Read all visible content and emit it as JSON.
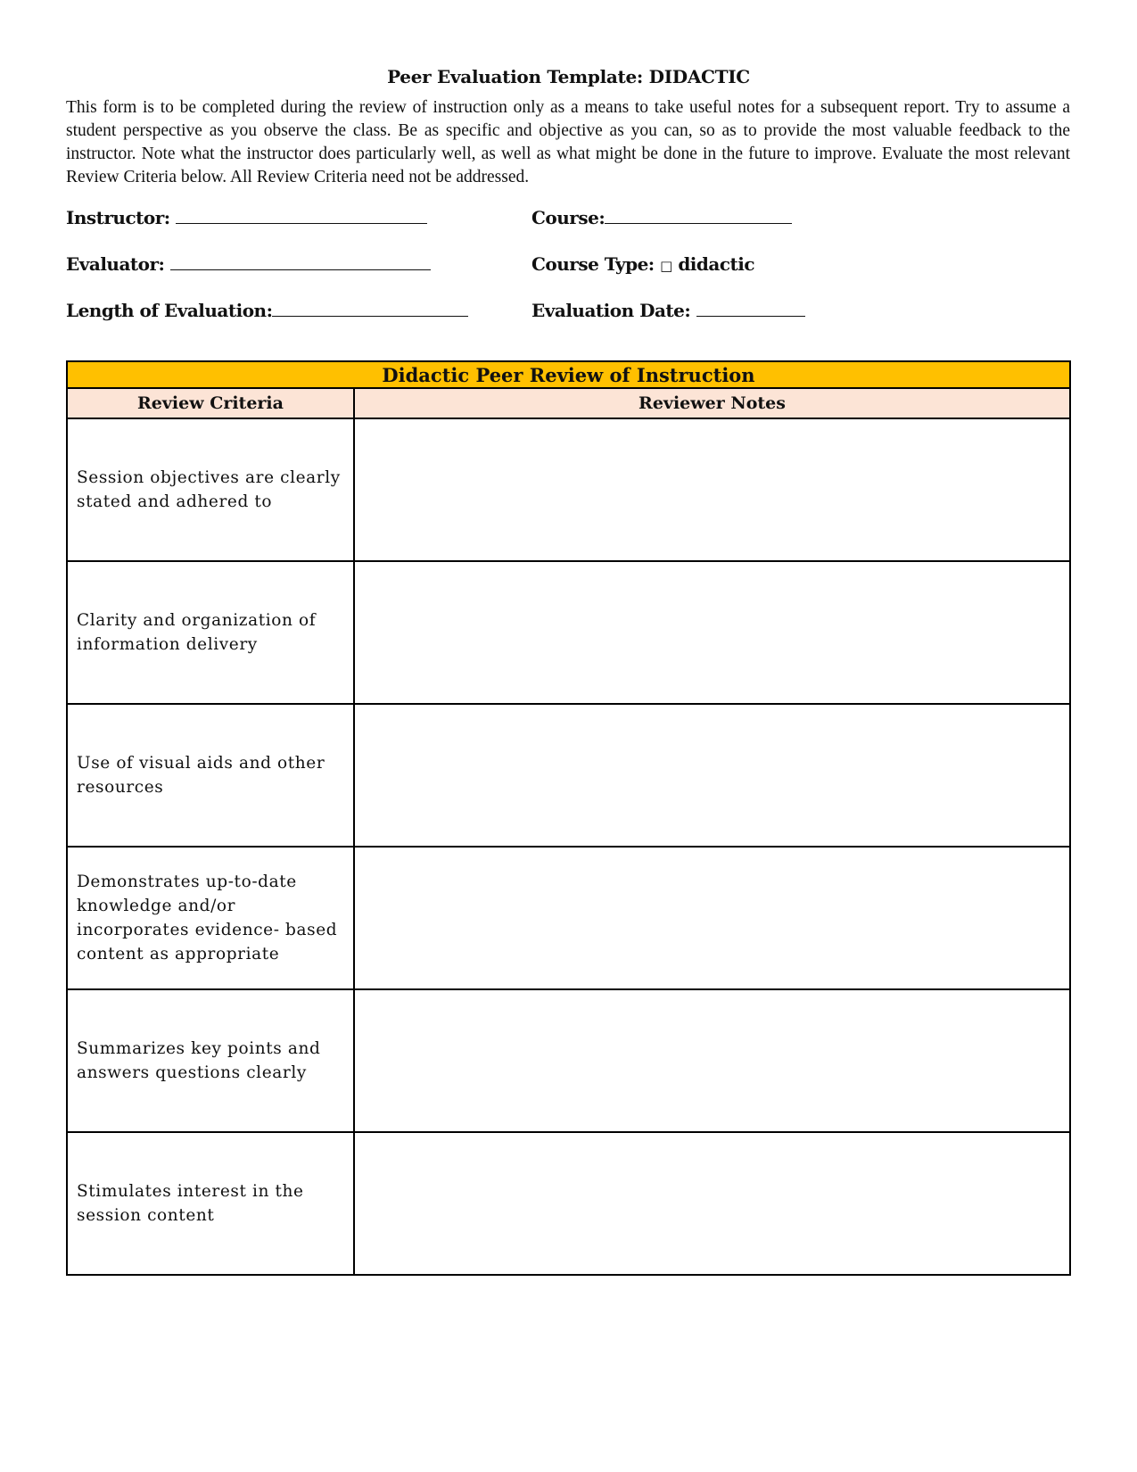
{
  "title": "Peer Evaluation Template: DIDACTIC",
  "intro": "This form is to be completed during the review of instruction only as a means to take useful notes for a subsequent report. Try to assume a student perspective as you observe the class. Be as specific and objective as you can, so as to provide the most valuable feedback to the instructor. Note what the instructor does particularly well, as well as what might be done in the future to improve. Evaluate the most relevant Review Criteria below. All Review Criteria need not be addressed.",
  "fields": {
    "instructor_label": "Instructor:",
    "course_label": "Course:",
    "evaluator_label": "Evaluator:",
    "course_type_label": "Course Type:",
    "course_type_option": "didactic",
    "checkbox_glyph": "□",
    "length_label": "Length of Evaluation:",
    "date_label": "Evaluation Date:"
  },
  "table": {
    "title": "Didactic Peer Review of Instruction",
    "col1": "Review Criteria",
    "col2": "Reviewer Notes",
    "rows": [
      "Session objectives are clearly stated and adhered to",
      "Clarity and organization of information delivery",
      "Use of visual aids and other resources",
      "Demonstrates up-to-date knowledge and/or incorporates evidence- based content as appropriate",
      "Summarizes key points and answers questions clearly",
      "Stimulates interest in the session content"
    ]
  },
  "colors": {
    "header": "#FFC000",
    "subheader": "#FCE4D6"
  }
}
